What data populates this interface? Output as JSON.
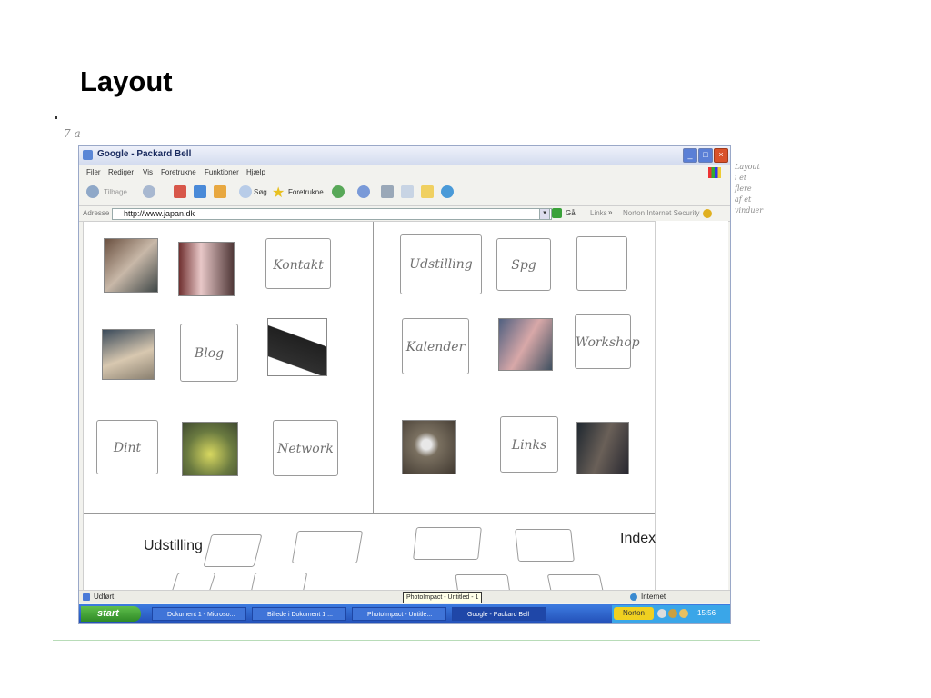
{
  "slide": {
    "title": "Layout",
    "margin_note": "7 a",
    "side_note": [
      "Layout",
      "i et",
      "flere",
      "af et",
      "vinduer"
    ]
  },
  "browser": {
    "window_title": "Google - Packard Bell",
    "menu": [
      "Filer",
      "Rediger",
      "Vis",
      "Foretrukne",
      "Funktioner",
      "Hjælp"
    ],
    "toolbar": {
      "back": "Tilbage",
      "search": "Søg",
      "favorites": "Foretrukne"
    },
    "address": {
      "label": "Adresse",
      "url": "http://www.japan.dk",
      "go": "Gå",
      "links": "Links",
      "norton": "Norton Internet Security"
    },
    "tiles_left": [
      {
        "label": "Kontakt"
      },
      {
        "label": "Blog"
      },
      {
        "label": "Dint"
      },
      {
        "label": "Network"
      }
    ],
    "tiles_right": [
      {
        "label": "Udstilling"
      },
      {
        "label": "Spg"
      },
      {
        "label": "Kalender"
      },
      {
        "label": "Workshop"
      },
      {
        "label": "Links"
      }
    ],
    "bottom_labels": {
      "left": "Udstilling",
      "right": "Index"
    },
    "status": {
      "left": "Udført",
      "center_popup": "PhotoImpact - Untitled - 1",
      "right": "Internet"
    }
  },
  "taskbar": {
    "start": "start",
    "tasks": [
      "Dokument 1 - Microso...",
      "Billede i Dokument 1 ...",
      "PhotoImpact - Untitle...",
      "Google - Packard Bell"
    ],
    "tray_norton": "Norton",
    "clock": "15:56"
  },
  "colors": {
    "taskbar_blue": "#2350b8",
    "start_green": "#3a9a2f",
    "close_red": "#d9522b"
  }
}
